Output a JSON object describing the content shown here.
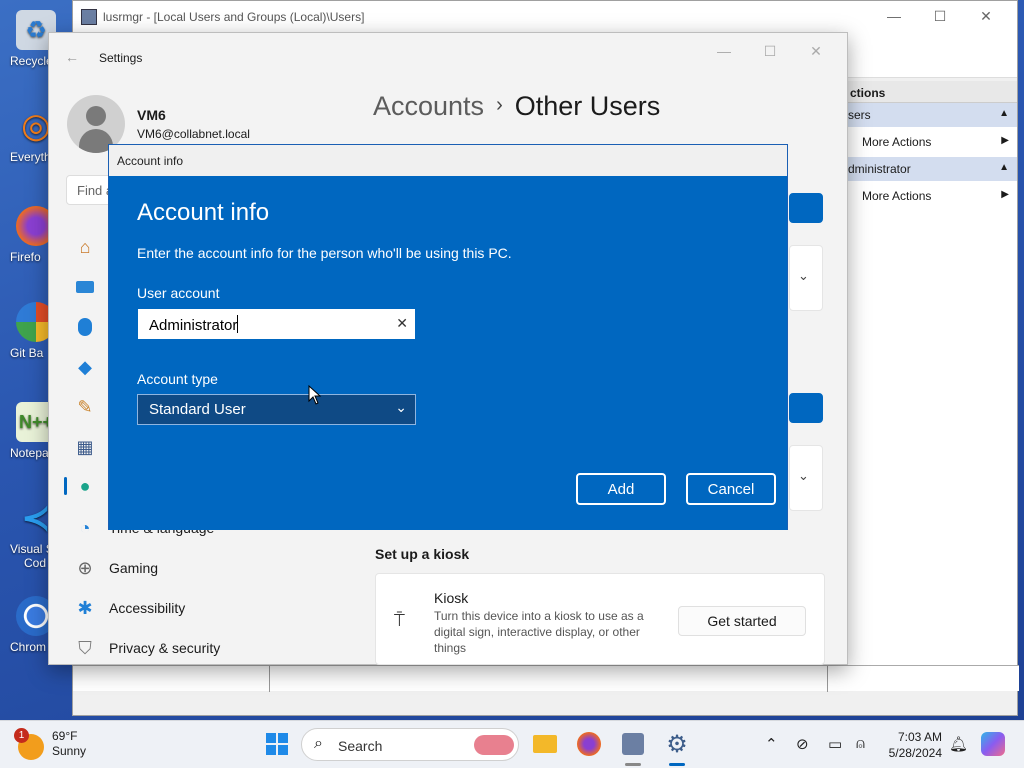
{
  "desktop": {
    "icons": [
      {
        "label": "Recycle",
        "icon": "recycle-bin-icon"
      },
      {
        "label": "Everyth",
        "icon": "everything-search-icon"
      },
      {
        "label": "Firefo",
        "icon": "firefox-icon"
      },
      {
        "label": "Git Ba",
        "icon": "git-bash-icon"
      },
      {
        "label": "Notepa",
        "icon": "notepad-plus-plus-icon"
      },
      {
        "label": "Visual S",
        "label2": "Cod",
        "icon": "vscode-icon"
      },
      {
        "label": "Chrom",
        "icon": "chrome-icon"
      }
    ]
  },
  "lusrmgr": {
    "title": "lusrmgr - [Local Users and Groups (Local)\\Users]",
    "actions": {
      "header": "ctions",
      "groups": [
        {
          "label": "sers",
          "item": "More Actions"
        },
        {
          "label": "dministrator",
          "item": "More Actions"
        }
      ]
    }
  },
  "settings": {
    "title": "Settings",
    "user": {
      "name": "VM6",
      "email": "VM6@collabnet.local"
    },
    "search_placeholder": "Find a",
    "breadcrumb": {
      "parent": "Accounts",
      "separator": "›",
      "current": "Other Users"
    },
    "nav": [
      {
        "label": "Time & language",
        "icon": "globe-clock-icon"
      },
      {
        "label": "Gaming",
        "icon": "gamepad-icon"
      },
      {
        "label": "Accessibility",
        "icon": "accessibility-icon"
      },
      {
        "label": "Privacy & security",
        "icon": "shield-icon"
      }
    ],
    "kiosk": {
      "heading": "Set up a kiosk",
      "title": "Kiosk",
      "description": "Turn this device into a kiosk to use as a digital sign, interactive display, or other things",
      "button": "Get started"
    }
  },
  "dialog": {
    "window_title": "Account info",
    "heading": "Account info",
    "description": "Enter the account info for the person who'll be using this PC.",
    "user_account_label": "User account",
    "user_account_value": "Administrator",
    "account_type_label": "Account type",
    "account_type_value": "Standard User",
    "add_label": "Add",
    "cancel_label": "Cancel"
  },
  "taskbar": {
    "weather": {
      "temp": "69°F",
      "condition": "Sunny",
      "badge": "1"
    },
    "search_label": "Search",
    "time": "7:03 AM",
    "date": "5/28/2024"
  },
  "colors": {
    "accent": "#0067c0",
    "dialog_bg": "#0067c0",
    "select_bg": "#0f4a85"
  }
}
